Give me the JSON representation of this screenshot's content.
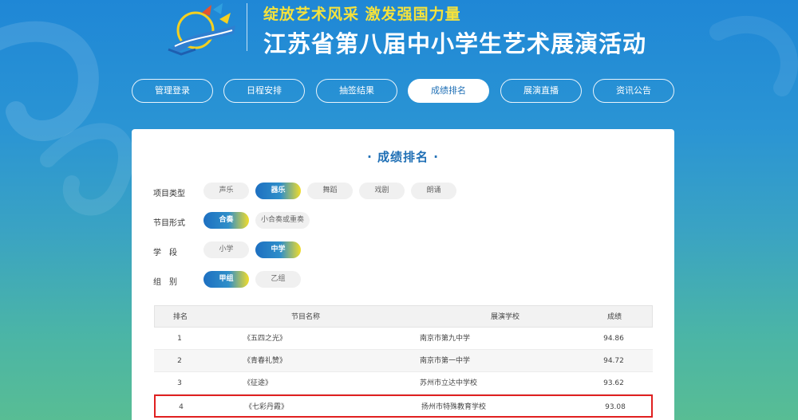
{
  "header": {
    "slogan": "绽放艺术风采  激发强国力量",
    "title": "江苏省第八届中小学生艺术展演活动"
  },
  "nav": {
    "items": [
      {
        "label": "管理登录",
        "active": false
      },
      {
        "label": "日程安排",
        "active": false
      },
      {
        "label": "抽签结果",
        "active": false
      },
      {
        "label": "成绩排名",
        "active": true
      },
      {
        "label": "展演直播",
        "active": false
      },
      {
        "label": "资讯公告",
        "active": false
      }
    ]
  },
  "card": {
    "title": "· 成绩排名 ·"
  },
  "filters": {
    "project_type": {
      "label": "项目类型",
      "options": [
        "声乐",
        "器乐",
        "舞蹈",
        "戏剧",
        "朗诵"
      ],
      "selected": "器乐"
    },
    "program_form": {
      "label": "节目形式",
      "options": [
        "合奏",
        "小合奏或重奏"
      ],
      "selected": "合奏"
    },
    "stage": {
      "label": "学　段",
      "options": [
        "小学",
        "中学"
      ],
      "selected": "中学"
    },
    "group": {
      "label": "组　别",
      "options": [
        "甲组",
        "乙组"
      ],
      "selected": "甲组"
    }
  },
  "table": {
    "headers": {
      "rank": "排名",
      "name": "节目名称",
      "school": "展演学校",
      "score": "成绩"
    },
    "rows": [
      {
        "rank": "1",
        "name": "《五四之光》",
        "school": "南京市第九中学",
        "score": "94.86"
      },
      {
        "rank": "2",
        "name": "《青春礼赞》",
        "school": "南京市第一中学",
        "score": "94.72"
      },
      {
        "rank": "3",
        "name": "《征途》",
        "school": "苏州市立达中学校",
        "score": "93.62"
      },
      {
        "rank": "4",
        "name": "《七彩丹霞》",
        "school": "扬州市特殊教育学校",
        "score": "93.08"
      }
    ]
  },
  "colors": {
    "accent": "#1f6fb5",
    "highlight_border": "#e02020",
    "slogan": "#f5e23c"
  }
}
